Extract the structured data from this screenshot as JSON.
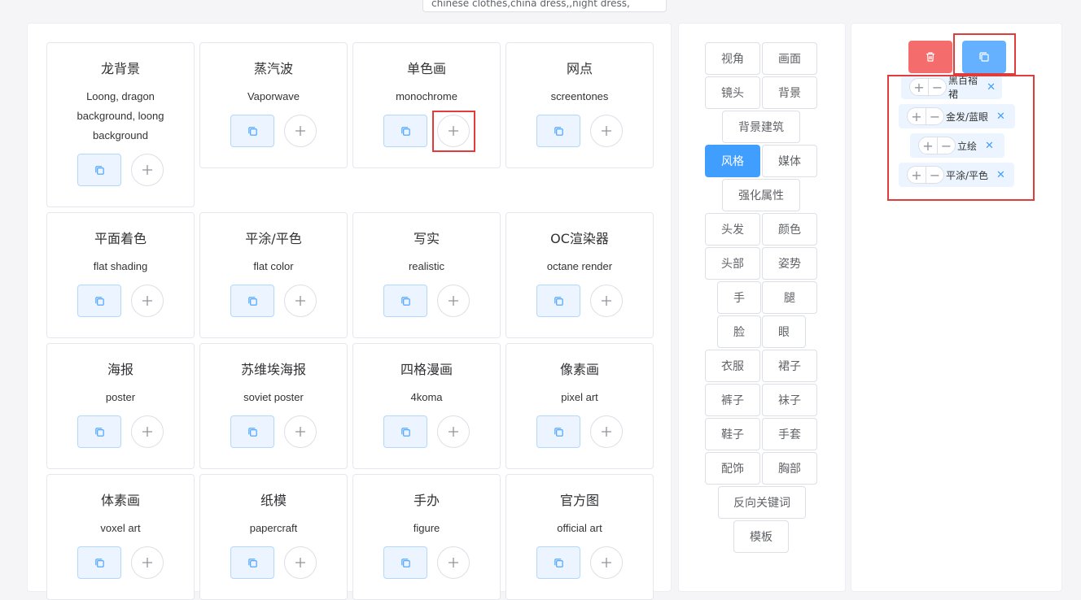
{
  "search": {
    "value": "chinese clothes,china dress,,night dress,"
  },
  "cards": [
    {
      "title": "龙背景",
      "sub": "Loong, dragon background, loong background"
    },
    {
      "title": "蒸汽波",
      "sub": "Vaporwave"
    },
    {
      "title": "单色画",
      "sub": "monochrome"
    },
    {
      "title": "网点",
      "sub": "screentones"
    },
    {
      "title": "平面着色",
      "sub": "flat shading"
    },
    {
      "title": "平涂/平色",
      "sub": "flat color"
    },
    {
      "title": "写实",
      "sub": "realistic"
    },
    {
      "title": "OC渲染器",
      "sub": "octane render"
    },
    {
      "title": "海报",
      "sub": "poster"
    },
    {
      "title": "苏维埃海报",
      "sub": "soviet poster"
    },
    {
      "title": "四格漫画",
      "sub": "4koma"
    },
    {
      "title": "像素画",
      "sub": "pixel art"
    },
    {
      "title": "体素画",
      "sub": "voxel art"
    },
    {
      "title": "纸模",
      "sub": "papercraft"
    },
    {
      "title": "手办",
      "sub": "figure"
    },
    {
      "title": "官方图",
      "sub": "official art"
    }
  ],
  "categories": [
    "视角",
    "画面",
    "镜头",
    "背景",
    "背景建筑",
    "风格",
    "媒体",
    "强化属性",
    "头发",
    "颜色",
    "头部",
    "姿势",
    "手",
    "腿",
    "脸",
    "眼",
    "衣服",
    "裙子",
    "裤子",
    "袜子",
    "鞋子",
    "手套",
    "配饰",
    "胸部",
    "反向关键词",
    "模板"
  ],
  "active_category": "风格",
  "selected_tags": [
    {
      "label": "黑百褶裙"
    },
    {
      "label": "金发/蓝眼"
    },
    {
      "label": "立绘"
    },
    {
      "label": "平涂/平色"
    }
  ],
  "colors": {
    "primary": "#409eff",
    "danger": "#f56c6c",
    "highlight": "#e03c3c"
  },
  "icons": {
    "copy": "copy-icon",
    "plus": "plus-icon",
    "delete": "trash-icon",
    "close": "close-icon"
  }
}
